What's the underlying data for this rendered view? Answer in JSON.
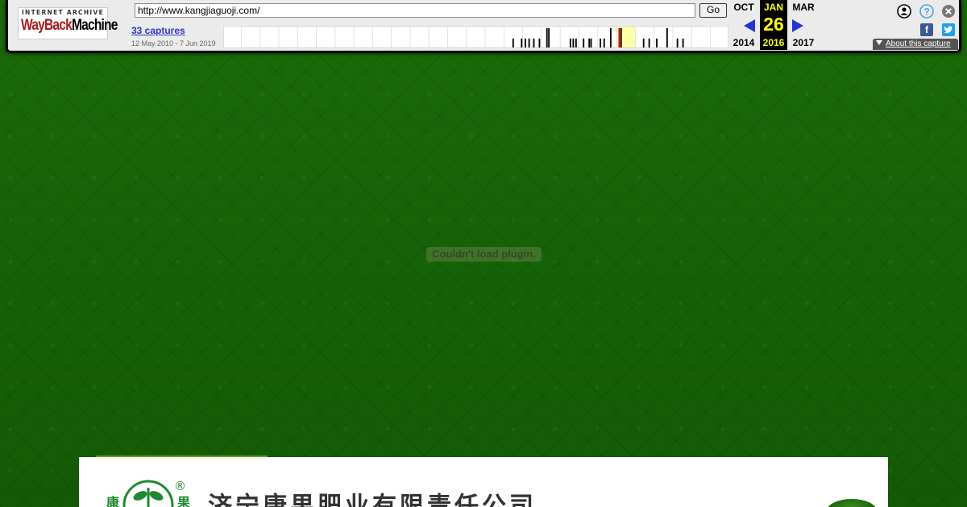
{
  "wayback": {
    "logo_top": "INTERNET ARCHIVE",
    "logo_word_red": "WayBack",
    "logo_word_black": "Machine",
    "url": "http://www.kangjiaguoji.com/",
    "go_label": "Go",
    "captures_label": "33 captures",
    "date_range": "12 May 2010 - 7 Jun 2019",
    "prev_month": "OCT",
    "prev_year": "2014",
    "current_month": "JAN",
    "current_day": "26",
    "current_year": "2016",
    "next_month": "MAR",
    "next_year": "2017",
    "about_label": "About this capture",
    "icons": [
      "user-icon",
      "help-icon",
      "close-icon",
      "facebook-icon",
      "twitter-icon",
      "prev-arrow-icon",
      "next-arrow-icon"
    ],
    "sparkline": {
      "years": 25,
      "highlight_year_index": 20,
      "bars": [
        {
          "year_index": 14,
          "offset": 0.45,
          "height": 12
        },
        {
          "year_index": 14,
          "offset": 0.9,
          "height": 12
        },
        {
          "year_index": 15,
          "offset": 0.1,
          "height": 12
        },
        {
          "year_index": 15,
          "offset": 0.3,
          "height": 12
        },
        {
          "year_index": 15,
          "offset": 0.55,
          "height": 12
        },
        {
          "year_index": 15,
          "offset": 0.85,
          "height": 12
        },
        {
          "year_index": 16,
          "offset": 0.25,
          "height": 26
        },
        {
          "year_index": 16,
          "offset": 0.35,
          "height": 26
        },
        {
          "year_index": 17,
          "offset": 0.5,
          "height": 12
        },
        {
          "year_index": 17,
          "offset": 0.65,
          "height": 12
        },
        {
          "year_index": 17,
          "offset": 0.8,
          "height": 12
        },
        {
          "year_index": 18,
          "offset": 0.2,
          "height": 12
        },
        {
          "year_index": 18,
          "offset": 0.5,
          "height": 12
        },
        {
          "year_index": 18,
          "offset": 0.6,
          "height": 12
        },
        {
          "year_index": 19,
          "offset": 0.1,
          "height": 12
        },
        {
          "year_index": 19,
          "offset": 0.3,
          "height": 12
        },
        {
          "year_index": 19,
          "offset": 0.65,
          "height": 26
        },
        {
          "year_index": 20,
          "offset": 0.1,
          "height": 26,
          "color": "#c01"
        },
        {
          "year_index": 20,
          "offset": 0.2,
          "height": 26
        },
        {
          "year_index": 21,
          "offset": 0.4,
          "height": 12
        },
        {
          "year_index": 21,
          "offset": 0.7,
          "height": 12
        },
        {
          "year_index": 22,
          "offset": 0.1,
          "height": 12
        },
        {
          "year_index": 22,
          "offset": 0.65,
          "height": 26
        },
        {
          "year_index": 23,
          "offset": 0.2,
          "height": 12
        },
        {
          "year_index": 23,
          "offset": 0.5,
          "height": 12
        }
      ]
    }
  },
  "page": {
    "plugin_message": "Couldn't load plugin.",
    "site_title": "济宁康果肥业有限责任公司",
    "registered_mark": "®"
  },
  "colors": {
    "page_background": "#155f06",
    "accent_strip": "#5fa61c",
    "wayback_current_bg": "#000000",
    "wayback_current_text": "#ffff00",
    "wayback_arrow": "#2233dd",
    "captures_link": "#3333cc"
  }
}
